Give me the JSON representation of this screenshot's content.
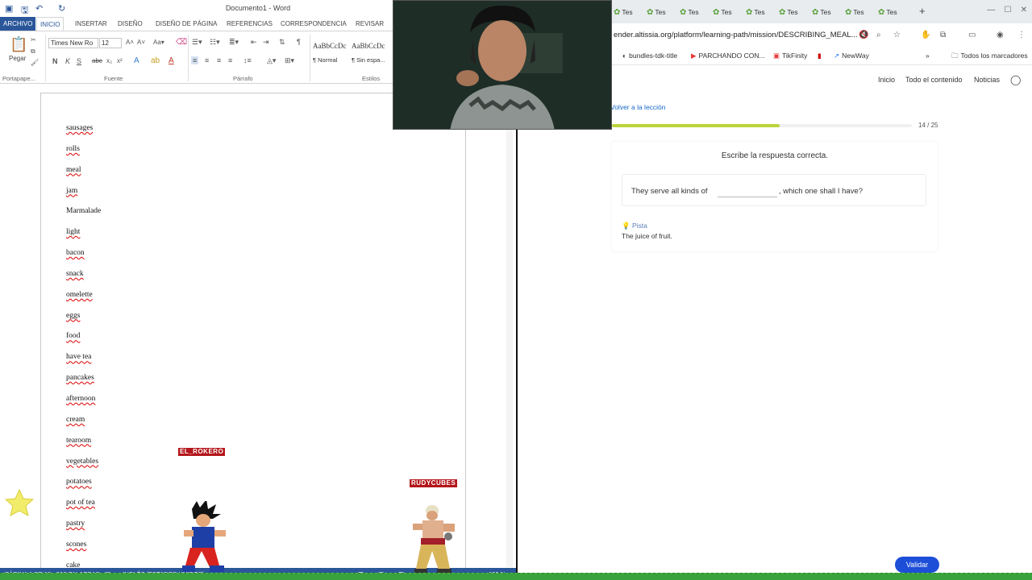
{
  "word": {
    "doc_title": "Documento1 - Word",
    "tabs": [
      "ARCHIVO",
      "INICIO",
      "INSERTAR",
      "DISEÑO",
      "DISEÑO DE PÁGINA",
      "REFERENCIAS",
      "CORRESPONDENCIA",
      "REVISAR"
    ],
    "ribbon": {
      "font_name": "Times New Ro",
      "font_size": "12",
      "paste_label": "Pegar",
      "groups": [
        "Portapape...",
        "Fuente",
        "Párrafo",
        "Estilos"
      ],
      "styles": [
        {
          "sample": "AaBbCcDc",
          "name": "¶ Normal"
        },
        {
          "sample": "AaBbCcDc",
          "name": "¶ Sin espa..."
        }
      ]
    },
    "words": [
      {
        "text": "sausages",
        "spell": true
      },
      {
        "text": "rolls",
        "spell": true
      },
      {
        "text": "meal",
        "spell": true
      },
      {
        "text": "jam",
        "spell": true
      },
      {
        "text": "Marmalade",
        "spell": false
      },
      {
        "text": "light",
        "spell": true
      },
      {
        "text": "bacon",
        "spell": true
      },
      {
        "text": "snack",
        "spell": true
      },
      {
        "text": "omelette",
        "spell": true
      },
      {
        "text": "eggs",
        "spell": true
      },
      {
        "text": "food",
        "spell": true
      },
      {
        "text": "have tea",
        "spell": true
      },
      {
        "text": "pancakes",
        "spell": true
      },
      {
        "text": "afternoon",
        "spell": true
      },
      {
        "text": "cream",
        "spell": true
      },
      {
        "text": "tearoom",
        "spell": true
      },
      {
        "text": "vegetables",
        "spell": true
      },
      {
        "text": "potatoes",
        "spell": true
      },
      {
        "text": "pot of tea",
        "spell": true
      },
      {
        "text": "pastry",
        "spell": true
      },
      {
        "text": "scones",
        "spell": true
      },
      {
        "text": "cake",
        "spell": true
      }
    ],
    "status": {
      "page": "PÁGINA 1 DE 10",
      "words": "310 PALABRAS",
      "language": "INGLÉS (ESTADOS UNIDOS)",
      "zoom": "100 %"
    }
  },
  "overlays": {
    "tag_left": "EL_ROKERO",
    "tag_right": "RUDYCUBES"
  },
  "browser": {
    "tab_label": "Tes",
    "url": "ender.altissia.org/platform/learning-path/mission/DESCRIBING_MEAL...",
    "bookmarks": [
      "bundles-tdk-title",
      "PARCHANDO CON...",
      "TikFinity",
      "NewWay"
    ],
    "all_bookmarks": "Todos los marcadores"
  },
  "site": {
    "nav": [
      "Inicio",
      "Todo el contenido",
      "Noticias"
    ],
    "back_link": "Volver a la lección",
    "progress": {
      "current": 14,
      "total": 25,
      "label": "14 / 25"
    },
    "instruction": "Escribe la respuesta correcta.",
    "question_before": "They serve all kinds of",
    "question_after": ", which one shall I have?",
    "answer_value": "",
    "hint_label": "Pista",
    "hint_text": "The juice of fruit.",
    "validate_label": "Validar"
  },
  "colors": {
    "word_blue": "#2b579a",
    "progress_fill": "#b9d43a",
    "validate_button": "#1d4ed8",
    "link_blue": "#1769c9"
  }
}
